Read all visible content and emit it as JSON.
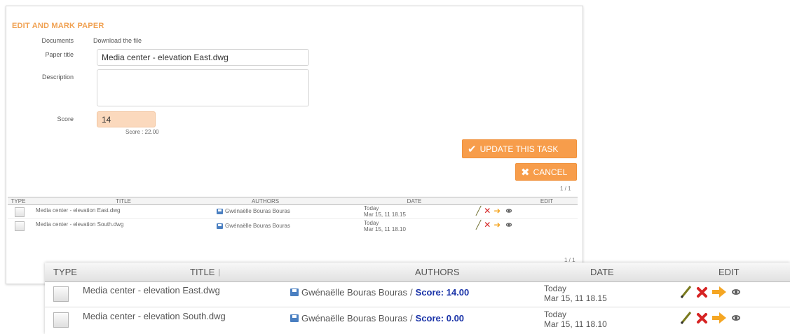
{
  "panel": {
    "title": "EDIT AND MARK PAPER",
    "documents_label": "Documents",
    "documents_value": "Download the file",
    "paper_title_label": "Paper title",
    "paper_title_value": "Media center - elevation East.dwg",
    "description_label": "Description",
    "description_value": "",
    "score_label": "Score",
    "score_value": "14",
    "score_hint": "Score : 22.00",
    "update_button": "UPDATE THIS TASK",
    "cancel_button": "CANCEL",
    "pager_top": "1 / 1",
    "pager_bottom": "1 / 1"
  },
  "table": {
    "headers": {
      "type": "TYPE",
      "title": "TITLE",
      "authors": "AUTHORS",
      "date": "DATE",
      "edit": "EDIT"
    },
    "rows": [
      {
        "title": "Media center - elevation East.dwg",
        "author": "Gwénaëlle Bouras Bouras",
        "score_label": "Score: 14.00",
        "date_day": "Today",
        "date_time": "Mar 15, 11 18.15"
      },
      {
        "title": "Media center - elevation South.dwg",
        "author": "Gwénaëlle Bouras Bouras",
        "score_label": "Score: 0.00",
        "date_day": "Today",
        "date_time": "Mar 15, 11 18.10"
      }
    ]
  },
  "icons": {
    "edit": "pencil-icon",
    "delete": "delete-x-icon",
    "forward": "arrow-right-icon",
    "view": "eye-icon",
    "file": "file-save-icon"
  },
  "colors": {
    "accent": "#f79d4b",
    "title": "#f0a152",
    "score_link": "#1a33a8",
    "score_input_bg": "#fbd9bd"
  }
}
